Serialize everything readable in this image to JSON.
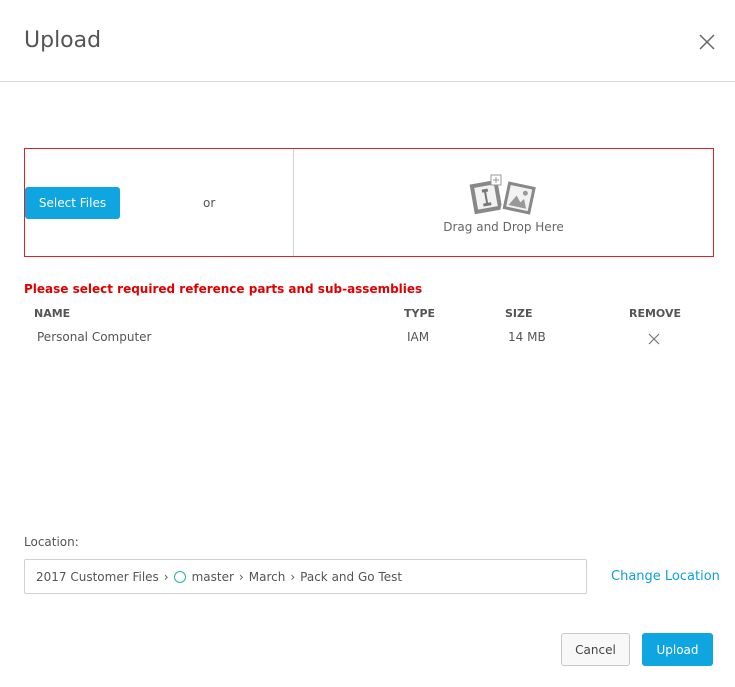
{
  "dialog": {
    "title": "Upload",
    "close_icon": "close-icon"
  },
  "dropzone": {
    "select_label": "Select Files",
    "or_text": "or",
    "drop_text": "Drag and Drop Here",
    "drop_icon": "drag-drop-files-icon",
    "border_color": "#d9232d"
  },
  "warning": {
    "text": "Please select required reference parts and sub-assemblies",
    "color": "#e00000"
  },
  "table": {
    "headers": {
      "name": "NAME",
      "type": "TYPE",
      "size": "SIZE",
      "remove": "REMOVE"
    },
    "rows": [
      {
        "name": "Personal Computer",
        "type": "IAM",
        "size": "14 MB",
        "remove_icon": "remove-x-icon"
      }
    ]
  },
  "location": {
    "label": "Location:",
    "crumbs": [
      "2017 Customer Files",
      "master",
      "March",
      "Pack and Go Test"
    ],
    "change_label": "Change Location"
  },
  "footer": {
    "cancel_label": "Cancel",
    "upload_label": "Upload"
  },
  "colors": {
    "primary": "#0ea5e0",
    "link": "#0e9fd8",
    "branch_circle": "#26b3a4"
  }
}
